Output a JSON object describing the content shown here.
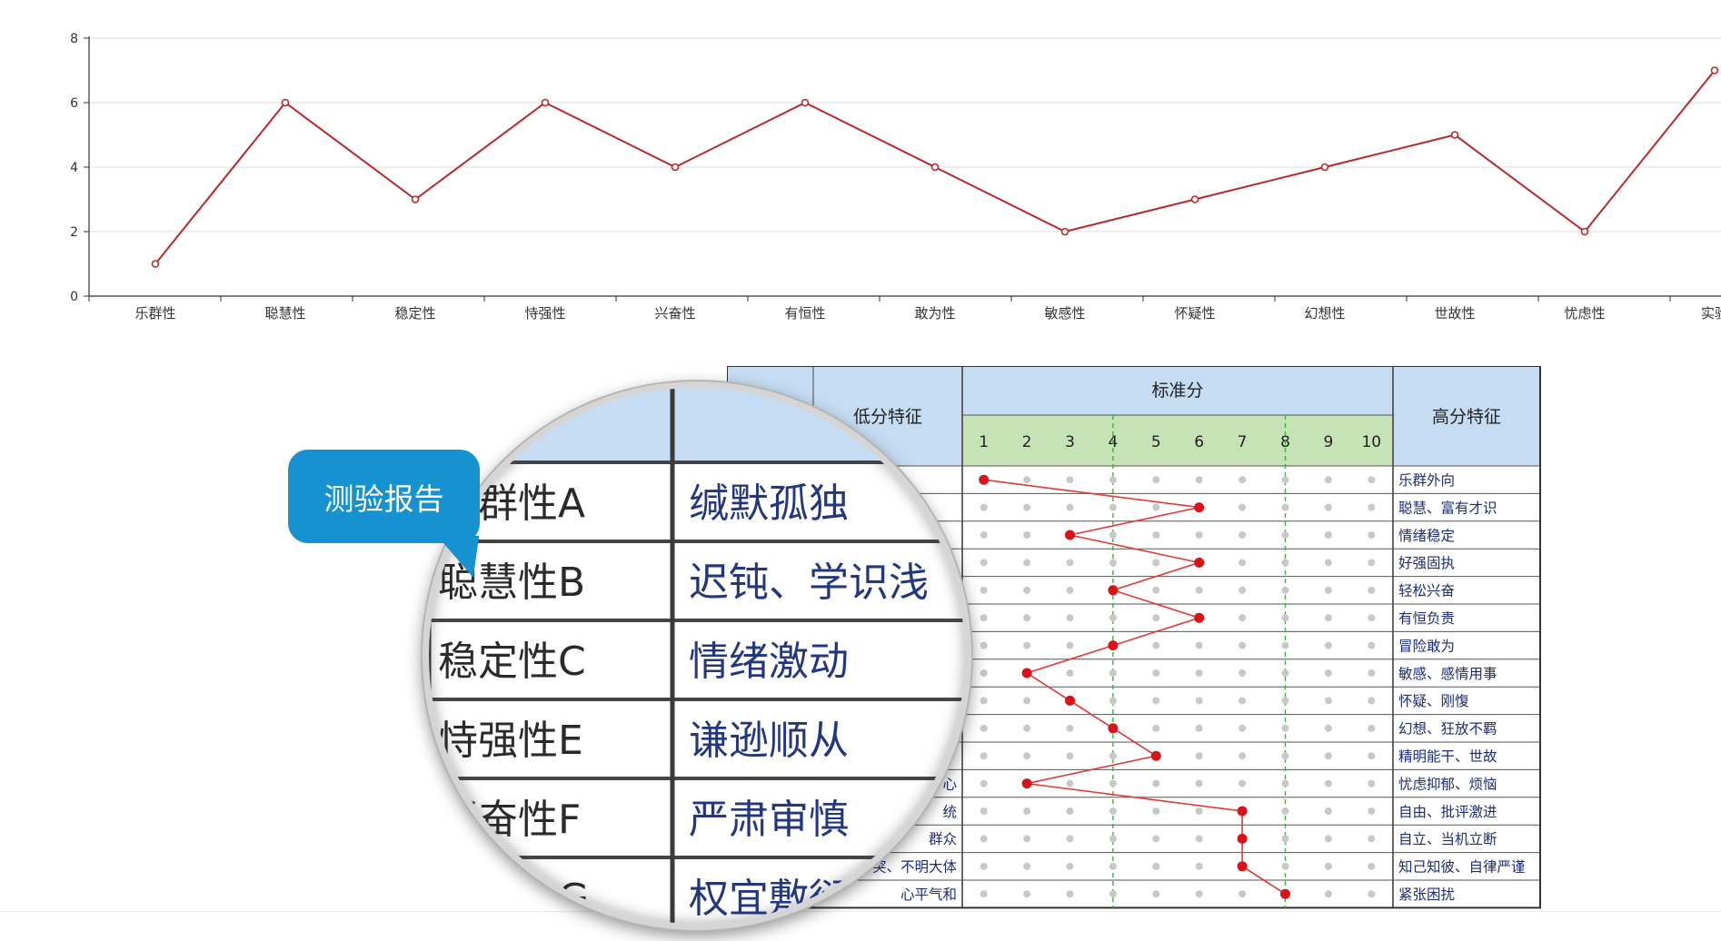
{
  "chart_data": [
    {
      "type": "line",
      "categories": [
        "乐群性",
        "聪慧性",
        "稳定性",
        "恃强性",
        "兴奋性",
        "有恒性",
        "敢为性",
        "敏感性",
        "怀疑性",
        "幻想性",
        "世故性",
        "忧虑性",
        "实验"
      ],
      "values": [
        1,
        6,
        3,
        6,
        4,
        6,
        4,
        2,
        3,
        4,
        5,
        2,
        7
      ],
      "ylim": [
        0,
        8
      ],
      "yticks": [
        0,
        2,
        4,
        6,
        8
      ],
      "grid": true,
      "color": "#b8292b"
    },
    {
      "type": "table",
      "headers": {
        "low": "低分特征",
        "score": "标准分",
        "high": "高分特征",
        "score_columns": [
          "1",
          "2",
          "3",
          "4",
          "5",
          "6",
          "7",
          "8",
          "9",
          "10"
        ]
      },
      "low_traits_visible": [
        "",
        "",
        "",
        "",
        "",
        "",
        "",
        "",
        "",
        "",
        "",
        "心",
        "统",
        "群众",
        "冲突、不明大体",
        "心平气和"
      ],
      "high_traits": [
        "乐群外向",
        "聪慧、富有才识",
        "情绪稳定",
        "好强固执",
        "轻松兴奋",
        "有恒负责",
        "冒险敢为",
        "敏感、感情用事",
        "怀疑、刚愎",
        "幻想、狂放不羁",
        "精明能干、世故",
        "忧虑抑郁、烦恼",
        "自由、批评激进",
        "自立、当机立断",
        "知己知彼、自律严谨",
        "紧张困扰"
      ],
      "scores": [
        1,
        6,
        3,
        6,
        4,
        6,
        4,
        2,
        3,
        4,
        5,
        2,
        7,
        7,
        7,
        8
      ],
      "colors": {
        "header_blue": "#c5dcf2",
        "header_green": "#c6e3b6",
        "line": "#e03a32",
        "dot_active": "#d8141a",
        "dot_idle": "#c8c8c8",
        "divider": "#3bb13b",
        "text_blue": "#1a2c7a"
      }
    }
  ],
  "magnifier": {
    "factors": [
      "乐群性A",
      "聪慧性B",
      "稳定性C",
      "恃强性E",
      "兴奋性F",
      "有恒性G"
    ],
    "low_traits": [
      "缄默孤独",
      "迟钝、学识浅",
      "情绪激动",
      "谦逊顺从",
      "严肃审慎",
      "权宜敷衍"
    ]
  },
  "callout": {
    "label": "测验报告",
    "color": "#1592cf"
  }
}
